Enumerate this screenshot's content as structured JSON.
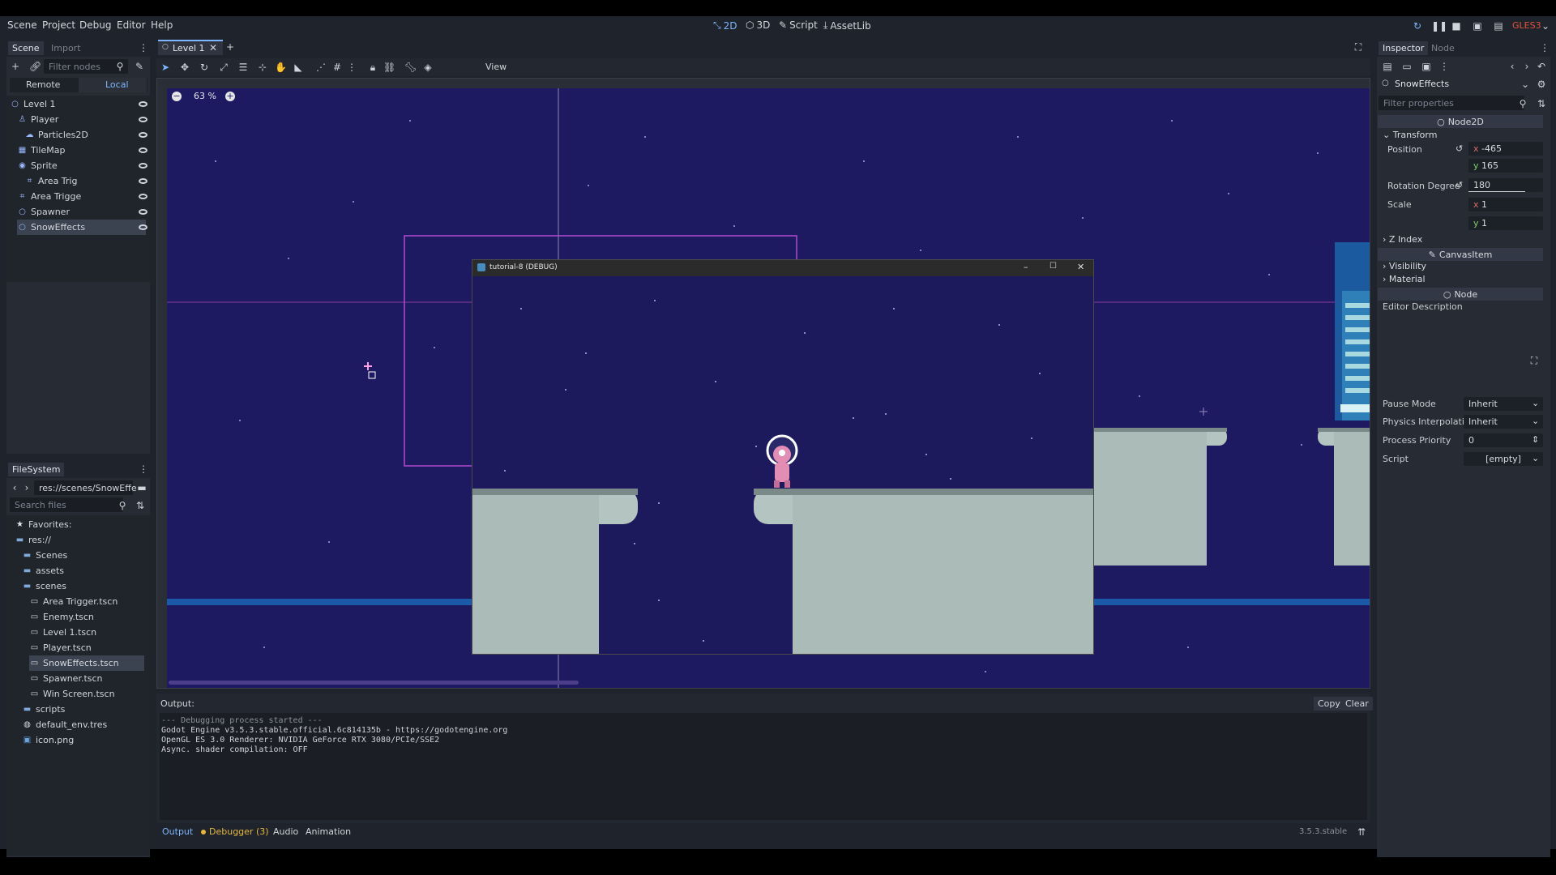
{
  "menu": [
    "Scene",
    "Project",
    "Debug",
    "Editor",
    "Help"
  ],
  "workspaces": [
    {
      "label": "2D",
      "icon": "2d-icon",
      "active": true
    },
    {
      "label": "3D",
      "icon": "3d-icon",
      "active": false
    },
    {
      "label": "Script",
      "icon": "script-icon",
      "active": false
    },
    {
      "label": "AssetLib",
      "icon": "assetlib-icon",
      "active": false
    }
  ],
  "renderer": "GLES3",
  "scene_dock": {
    "tabs": [
      "Scene",
      "Import"
    ],
    "filter_placeholder": "Filter nodes",
    "remote_label": "Remote",
    "local_label": "Local",
    "nodes": [
      {
        "name": "Level 1",
        "icon": "node2d-icon",
        "indent": 0
      },
      {
        "name": "Player",
        "icon": "kinematic-icon",
        "indent": 1
      },
      {
        "name": "Particles2D",
        "icon": "particles-icon",
        "indent": 2
      },
      {
        "name": "TileMap",
        "icon": "tilemap-icon",
        "indent": 1
      },
      {
        "name": "Sprite",
        "icon": "sprite-icon",
        "indent": 1
      },
      {
        "name": "Area Trig",
        "icon": "area-icon",
        "indent": 2
      },
      {
        "name": "Area Trigge",
        "icon": "area-icon",
        "indent": 1
      },
      {
        "name": "Spawner",
        "icon": "node2d-icon",
        "indent": 1
      },
      {
        "name": "SnowEffects",
        "icon": "node2d-icon",
        "indent": 1,
        "selected": true
      }
    ]
  },
  "filesystem": {
    "title": "FileSystem",
    "path": "res://scenes/SnowEffe",
    "search_placeholder": "Search files",
    "items": [
      {
        "name": "Favorites:",
        "icon": "star-icon",
        "indent": 0
      },
      {
        "name": "res://",
        "icon": "folder-icon",
        "indent": 0
      },
      {
        "name": "Scenes",
        "icon": "folder-icon",
        "indent": 1
      },
      {
        "name": "assets",
        "icon": "folder-icon",
        "indent": 1
      },
      {
        "name": "scenes",
        "icon": "folder-icon",
        "indent": 1
      },
      {
        "name": "Area Trigger.tscn",
        "icon": "scene-file-icon",
        "indent": 2
      },
      {
        "name": "Enemy.tscn",
        "icon": "scene-file-icon",
        "indent": 2
      },
      {
        "name": "Level 1.tscn",
        "icon": "scene-file-icon",
        "indent": 2
      },
      {
        "name": "Player.tscn",
        "icon": "scene-file-icon",
        "indent": 2
      },
      {
        "name": "SnowEffects.tscn",
        "icon": "scene-file-icon",
        "indent": 2,
        "selected": true
      },
      {
        "name": "Spawner.tscn",
        "icon": "scene-file-icon",
        "indent": 2
      },
      {
        "name": "Win Screen.tscn",
        "icon": "scene-file-icon",
        "indent": 2
      },
      {
        "name": "scripts",
        "icon": "folder-icon",
        "indent": 1
      },
      {
        "name": "default_env.tres",
        "icon": "env-icon",
        "indent": 1
      },
      {
        "name": "icon.png",
        "icon": "image-icon",
        "indent": 1
      }
    ]
  },
  "editor": {
    "tab_label": "Level 1",
    "view_label": "View",
    "zoom": "63 %"
  },
  "debug_window": {
    "title": "tutorial-8 (DEBUG)"
  },
  "output": {
    "title": "Output:",
    "copy_label": "Copy",
    "clear_label": "Clear",
    "lines": [
      "--- Debugging process started ---",
      "Godot Engine v3.5.3.stable.official.6c814135b - https://godotengine.org",
      "OpenGL ES 3.0 Renderer: NVIDIA GeForce RTX 3080/PCIe/SSE2",
      "Async. shader compilation: OFF"
    ],
    "bottom_tabs": [
      "Output",
      "Debugger (3)",
      "Audio",
      "Animation"
    ],
    "version": "3.5.3.stable"
  },
  "inspector": {
    "tabs": [
      "Inspector",
      "Node"
    ],
    "object_name": "SnowEffects",
    "filter_placeholder": "Filter properties",
    "class_node2d": "Node2D",
    "transform_label": "Transform",
    "position_label": "Position",
    "position_x": "-465",
    "position_y": "165",
    "rotation_label": "Rotation Degree",
    "rotation_value": "180",
    "scale_label": "Scale",
    "scale_x": "1",
    "scale_y": "1",
    "zindex_label": "Z Index",
    "class_canvasitem": "CanvasItem",
    "visibility_label": "Visibility",
    "material_label": "Material",
    "class_node": "Node",
    "editor_desc_label": "Editor Description",
    "pause_mode_label": "Pause Mode",
    "pause_mode_value": "Inherit",
    "physics_label": "Physics Interpolati",
    "physics_value": "Inherit",
    "priority_label": "Process Priority",
    "priority_value": "0",
    "script_label": "Script",
    "script_value": "[empty]",
    "x": "x",
    "y": "y"
  }
}
